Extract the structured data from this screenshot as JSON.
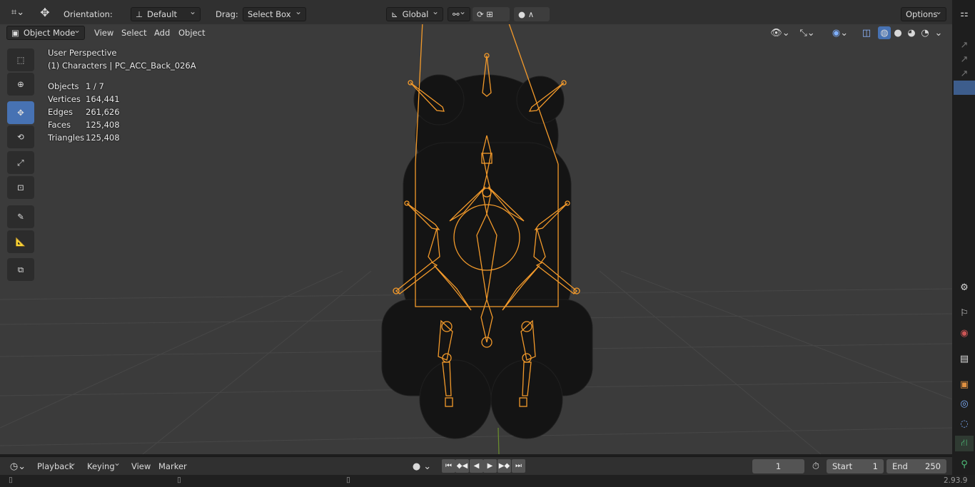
{
  "topbar": {
    "orientation_label": "Orientation:",
    "orientation_value": "Default",
    "drag_label": "Drag:",
    "drag_value": "Select Box",
    "transform_space": "Global",
    "options_label": "Options"
  },
  "header": {
    "mode": "Object Mode",
    "menu": [
      "View",
      "Select",
      "Add",
      "Object"
    ]
  },
  "overlay": {
    "view_name": "User Perspective",
    "context": "(1) Characters | PC_ACC_Back_026A"
  },
  "stats": [
    {
      "key": "Objects",
      "value": "1 / 7"
    },
    {
      "key": "Vertices",
      "value": "164,441"
    },
    {
      "key": "Edges",
      "value": "261,626"
    },
    {
      "key": "Faces",
      "value": "125,408"
    },
    {
      "key": "Triangles",
      "value": "125,408"
    }
  ],
  "tools": [
    {
      "name": "select-box-icon",
      "active": false
    },
    {
      "name": "cursor-icon",
      "active": false
    },
    {
      "name": "move-icon",
      "active": true
    },
    {
      "name": "rotate-icon",
      "active": false
    },
    {
      "name": "scale-icon",
      "active": false
    },
    {
      "name": "transform-icon",
      "active": false
    },
    {
      "name": "annotate-icon",
      "active": false
    },
    {
      "name": "measure-icon",
      "active": false
    },
    {
      "name": "add-cube-icon",
      "active": false
    }
  ],
  "timeline": {
    "menu": [
      "Playback",
      "Keying",
      "View",
      "Marker"
    ],
    "current_frame": "1",
    "start_label": "Start",
    "start_value": "1",
    "end_label": "End",
    "end_value": "250"
  },
  "status": {
    "version": "2.93.9"
  },
  "colors": {
    "armature": "#f39a2b",
    "active_tool": "#4772b3",
    "viewport_bg": "#3b3b3b"
  }
}
